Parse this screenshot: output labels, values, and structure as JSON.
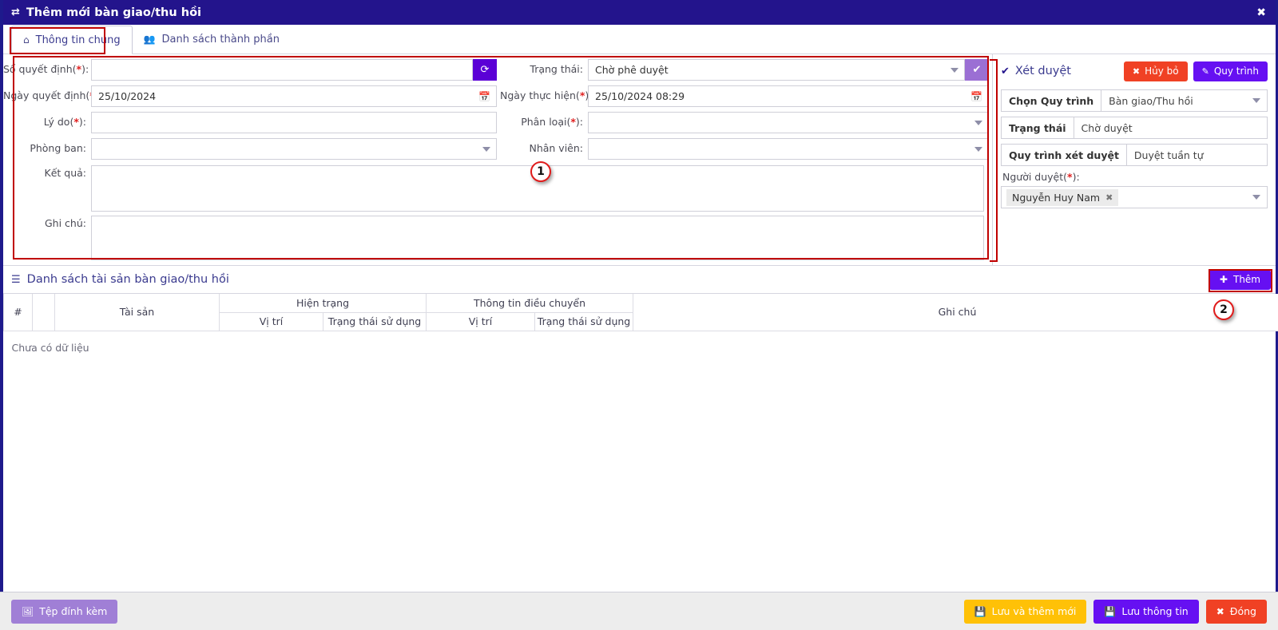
{
  "window": {
    "title": "Thêm mới bàn giao/thu hồi",
    "title_icon": "exchange-icon",
    "close_icon": "✖",
    "header_bg": "#23148c"
  },
  "tabs": [
    {
      "label": "Thông tin chung",
      "icon": "home-icon",
      "active": true
    },
    {
      "label": "Danh sách thành phần",
      "icon": "users-icon",
      "active": false
    }
  ],
  "form": {
    "left": [
      {
        "label": "Số quyết định",
        "required": true,
        "value": "",
        "type": "text-with-button",
        "button_icon": "refresh-icon"
      },
      {
        "label": "Ngày quyết định",
        "required": true,
        "value": "25/10/2024",
        "type": "date",
        "icon": "calendar-icon"
      },
      {
        "label": "Lý do",
        "required": true,
        "value": "",
        "type": "text"
      },
      {
        "label": "Phòng ban",
        "required": false,
        "value": "",
        "type": "select"
      },
      {
        "label": "Kết quả",
        "required": false,
        "value": "",
        "type": "textarea"
      },
      {
        "label": "Ghi chú",
        "required": false,
        "value": "",
        "type": "textarea"
      }
    ],
    "right": [
      {
        "label": "Trạng thái",
        "required": false,
        "value": "Chờ phê duyệt",
        "type": "select-with-button",
        "button_icon": "check-circle-icon"
      },
      {
        "label": "Ngày thực hiện",
        "required": true,
        "value": "25/10/2024 08:29",
        "type": "datetime",
        "icon": "calendar-icon"
      },
      {
        "label": "Phân loại",
        "required": true,
        "value": "",
        "type": "select"
      },
      {
        "label": "Nhân viên",
        "required": false,
        "value": "",
        "type": "select"
      }
    ]
  },
  "approval": {
    "title": "Xét duyệt",
    "title_icon": "check-icon",
    "cancel_button": {
      "label": "Hủy bỏ",
      "icon": "times-icon",
      "color": "#f04124"
    },
    "process_button": {
      "label": "Quy trình",
      "icon": "pencil-icon",
      "color": "#6610f2"
    },
    "rows": [
      {
        "label": "Chọn Quy trình",
        "value": "Bàn giao/Thu hồi",
        "has_caret": true
      },
      {
        "label": "Trạng thái",
        "value": "Chờ duyệt",
        "has_caret": false
      },
      {
        "label": "Quy trình xét duyệt",
        "value": "Duyệt tuần tự",
        "has_caret": false
      }
    ],
    "approver_label": "Người duyệt",
    "approver_required": true,
    "approver_tags": [
      {
        "name": "Nguyễn Huy Nam",
        "remove_icon": "✖"
      }
    ]
  },
  "asset_section": {
    "title": "Danh sách tài sản bàn giao/thu hồi",
    "icon": "list-icon",
    "add_button": {
      "label": "Thêm",
      "icon": "plus-icon"
    },
    "columns": {
      "index": "#",
      "blank": "",
      "asset": "Tài sản",
      "current_group": "Hiện trạng",
      "transfer_group": "Thông tin điều chuyển",
      "current_location": "Vị trí",
      "current_status": "Trạng thái sử dụng",
      "transfer_location": "Vị trí",
      "transfer_status": "Trạng thái sử dụng",
      "note": "Ghi chú"
    },
    "empty_text": "Chưa có dữ liệu",
    "rows": []
  },
  "footer": {
    "attach_button": {
      "label": "Tệp đính kèm",
      "icon": "image-icon",
      "color": "#a07fd6"
    },
    "save_new_button": {
      "label": "Lưu và thêm mới",
      "icon": "save-icon",
      "color": "#ffc107"
    },
    "save_button": {
      "label": "Lưu thông tin",
      "icon": "save-icon",
      "color": "#6610f2"
    },
    "close_button": {
      "label": "Đóng",
      "icon": "times-icon",
      "color": "#f04124"
    }
  },
  "annotations": [
    {
      "number": "1"
    },
    {
      "number": "2"
    }
  ]
}
